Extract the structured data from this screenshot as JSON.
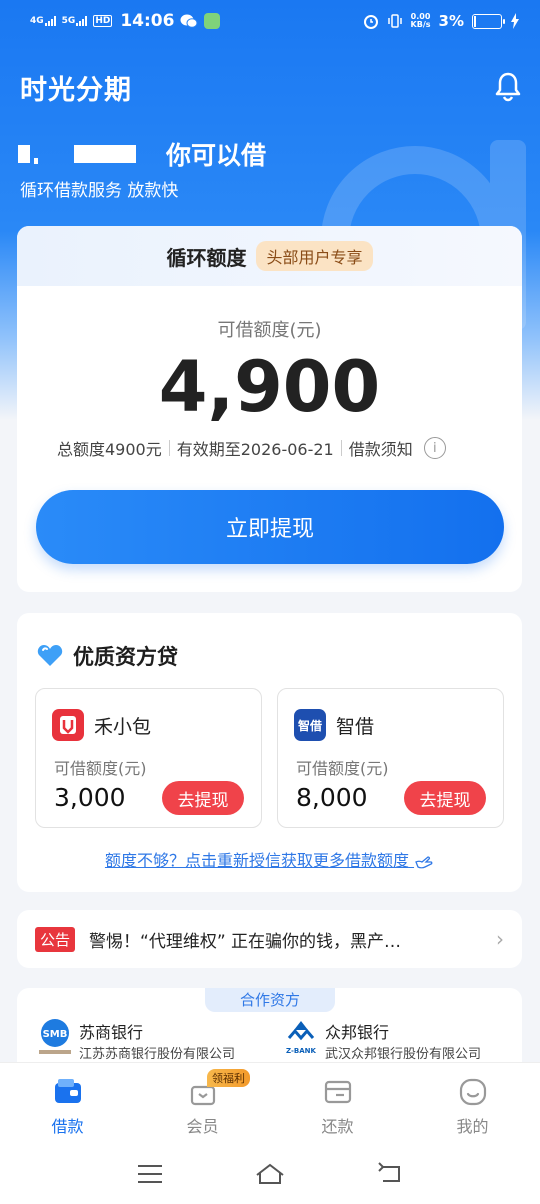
{
  "status_bar": {
    "signal_1": "4G",
    "signal_2": "5G",
    "hd": "HD",
    "time": "14:06",
    "net_speed_top": "0.00",
    "net_speed_unit": "KB/s",
    "battery": "3%"
  },
  "header": {
    "app_title": "时光分期",
    "bell_icon": "bell-icon"
  },
  "greeting": {
    "main": "你可以借",
    "sub": "循环借款服务 放款快"
  },
  "credit_card": {
    "title": "循环额度",
    "tag": "头部用户专享",
    "available_label": "可借额度(元)",
    "amount": "4,900",
    "total": "总额度4900元",
    "valid_until": "有效期至2026-06-21",
    "terms_link": "借款须知",
    "info_icon": "i",
    "withdraw_button": "立即提现"
  },
  "quality_loans": {
    "title": "优质资方贷",
    "icon": "heart-icon",
    "lenders": [
      {
        "name": "禾小包",
        "logo_text": "禾",
        "label": "可借额度(元)",
        "amount": "3,000",
        "button": "去提现",
        "color": "#e8323c"
      },
      {
        "name": "智借",
        "logo_text": "智借",
        "label": "可借额度(元)",
        "amount": "8,000",
        "button": "去提现",
        "color": "#1e4fb0"
      }
    ],
    "more_link": "额度不够？点击重新授信获取更多借款额度"
  },
  "notice": {
    "tag": "公告",
    "text": "警惕！“代理维权” 正在骗你的钱，黑产…"
  },
  "partners": {
    "tag": "合作资方",
    "banks": [
      {
        "name": "苏商银行",
        "full": "江苏苏商银行股份有限公司",
        "logo_text": "SMB"
      },
      {
        "name": "众邦银行",
        "full": "武汉众邦银行股份有限公司",
        "logo_text": "Z-BANK"
      }
    ]
  },
  "tabbar": {
    "badge": "领福利",
    "tabs": [
      {
        "label": "借款",
        "icon": "wallet-icon"
      },
      {
        "label": "会员",
        "icon": "gift-icon"
      },
      {
        "label": "还款",
        "icon": "card-icon"
      },
      {
        "label": "我的",
        "icon": "smile-icon"
      }
    ]
  },
  "colors": {
    "primary": "#1a72ee",
    "danger": "#f0434a",
    "tag_bg": "#fbe3c4"
  }
}
